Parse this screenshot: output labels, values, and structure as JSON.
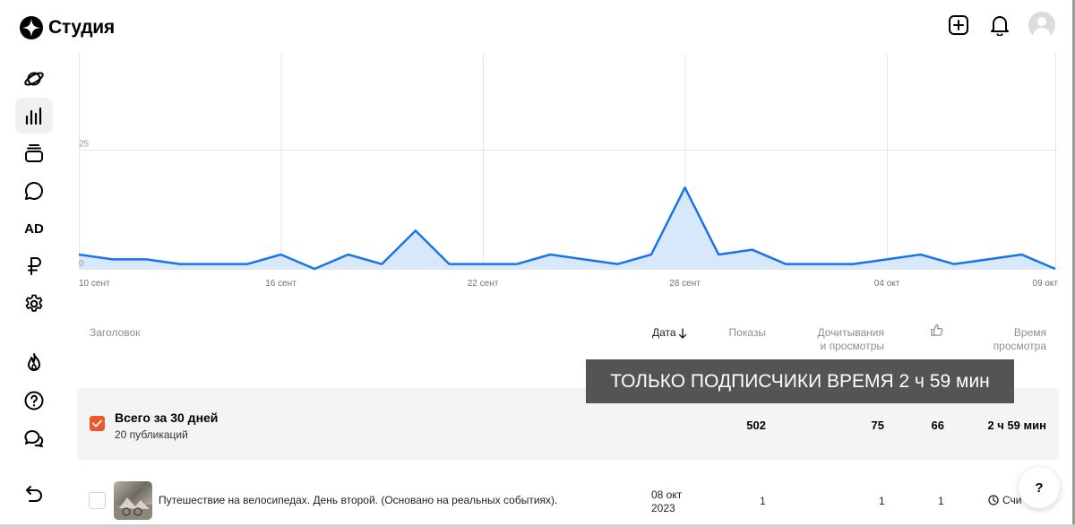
{
  "app": {
    "name": "Студия"
  },
  "sidebar": {
    "items": [
      {
        "icon": "planet-icon"
      },
      {
        "icon": "stats-icon",
        "active": true
      },
      {
        "icon": "publications-stack-icon"
      },
      {
        "icon": "comments-icon"
      },
      {
        "icon": "ad-icon",
        "label": "AD"
      },
      {
        "icon": "ruble-icon"
      },
      {
        "icon": "gear-icon"
      },
      {
        "icon": "flame-icon"
      },
      {
        "icon": "help-circle-icon"
      },
      {
        "icon": "chat-icon"
      },
      {
        "icon": "back-arrow-icon"
      }
    ]
  },
  "chart_data": {
    "type": "area",
    "x": [
      "10 сент",
      "11 сент",
      "12 сент",
      "13 сент",
      "14 сент",
      "15 сент",
      "16 сент",
      "17 сент",
      "18 сент",
      "19 сент",
      "20 сент",
      "21 сент",
      "22 сент",
      "23 сент",
      "24 сент",
      "25 сент",
      "26 сент",
      "27 сент",
      "28 сент",
      "29 сент",
      "30 сент",
      "01 окт",
      "02 окт",
      "03 окт",
      "04 окт",
      "05 окт",
      "06 окт",
      "07 окт",
      "08 окт",
      "09 окт"
    ],
    "x_ticks": [
      "10 сент",
      "16 сент",
      "22 сент",
      "28 сент",
      "04 окт",
      "09 окт"
    ],
    "y_ticks": [
      0,
      25
    ],
    "values": [
      3,
      2,
      2,
      1,
      1,
      1,
      3,
      0,
      3,
      1,
      8,
      1,
      1,
      1,
      3,
      2,
      1,
      3,
      17,
      3,
      4,
      1,
      1,
      1,
      2,
      3,
      1,
      2,
      3,
      0
    ],
    "ylim": [
      0,
      45
    ],
    "grid": true,
    "line_color": "#1a73e8",
    "fill_color": "#d7e8fb"
  },
  "table": {
    "headers": {
      "title": "Заголовок",
      "date": "Дата",
      "views": "Показы",
      "reads_line1": "Дочитывания",
      "reads_line2": "и просмотры",
      "time_line1": "Время",
      "time_line2": "просмотра"
    },
    "summary": {
      "title": "Всего за 30 дней",
      "subtitle": "20 публикаций",
      "views": "502",
      "reads": "75",
      "likes": "66",
      "time": "2 ч 59 мин"
    },
    "rows": [
      {
        "title": "Путешествие на велосипедах. День второй. (Основано на реальных событиях).",
        "date_line1": "08 окт",
        "date_line2": "2023",
        "views": "1",
        "reads": "1",
        "likes": "1",
        "status": "Счи"
      }
    ]
  },
  "tooltip": {
    "text": "ТОЛЬКО ПОДПИСЧИКИ ВРЕМЯ 2 ч 59 мин"
  },
  "help_button": {
    "label": "?"
  },
  "colors": {
    "accent": "#f0572a",
    "chart_line": "#1a73e8"
  }
}
